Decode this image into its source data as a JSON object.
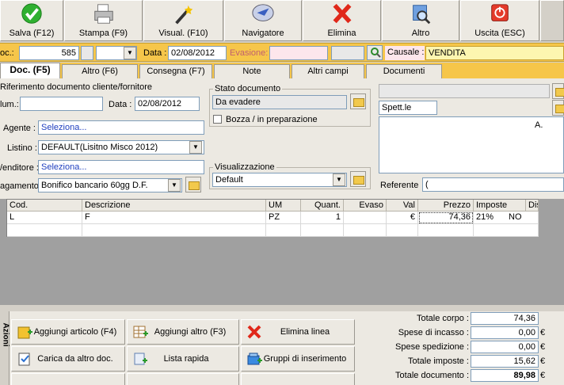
{
  "toolbar": {
    "buttons": [
      {
        "label": "Salva (F12)",
        "icon": "green-check-icon"
      },
      {
        "label": "Stampa (F9)",
        "icon": "printer-icon"
      },
      {
        "label": "Visual. (F10)",
        "icon": "magic-wand-icon"
      },
      {
        "label": "Navigatore",
        "icon": "compass-icon"
      },
      {
        "label": "Elimina",
        "icon": "red-x-icon"
      },
      {
        "label": "Altro",
        "icon": "magnifier-icon"
      },
      {
        "label": "Uscita (ESC)",
        "icon": "exit-icon"
      }
    ]
  },
  "header": {
    "doc_label": "oc.:",
    "doc_number": "585",
    "data_label": "Data :",
    "data_value": "02/08/2012",
    "evasione_label": "Evasione:",
    "evasione_value": "",
    "causale_label": "Causale :",
    "causale_value": "VENDITA"
  },
  "tabs": [
    "Doc. (F5)",
    "Altro (F6)",
    "Consegna (F7)",
    "Note",
    "Altri campi",
    "Documenti"
  ],
  "riferimento": {
    "title": "Riferimento documento cliente/fornitore",
    "num_label": "lum.:",
    "num_value": "",
    "data_label": "Data :",
    "data_value": "02/08/2012"
  },
  "fields": {
    "agente_label": "Agente :",
    "agente_value": "Seleziona...",
    "listino_label": "Listino :",
    "listino_value": "DEFAULT(Lisitno Misco 2012)",
    "venditore_label": "/enditore :",
    "venditore_value": "Seleziona...",
    "pagamento_label": "agamento :",
    "pagamento_value": "Bonifico bancario 60gg D.F."
  },
  "stato": {
    "title": "Stato documento",
    "value": "Da evadere",
    "bozza_label": "Bozza / in preparazione"
  },
  "visualizzazione": {
    "title": "Visualizzazione",
    "value": "Default"
  },
  "cliente": {
    "spett": "Spett.le",
    "a_label": "A.",
    "referente_label": "Referente",
    "referente_value": "("
  },
  "grid": {
    "columns": [
      "Cod.",
      "Descrizione",
      "UM",
      "Quant.",
      "Evaso",
      "Val",
      "Prezzo",
      "Imposte",
      "Disp."
    ],
    "rows": [
      [
        "L",
        "F",
        "PZ",
        "1",
        "",
        "€",
        "74,36",
        "21%",
        "NO"
      ]
    ]
  },
  "actions": [
    {
      "label": "Aggiungi articolo (F4)",
      "icon": "add-article-icon"
    },
    {
      "label": "Aggiungi altro (F3)",
      "icon": "add-other-icon"
    },
    {
      "label": "Elimina linea",
      "icon": "delete-line-icon"
    },
    {
      "label": "Carica da altro doc.",
      "icon": "load-doc-icon"
    },
    {
      "label": "Lista rapida",
      "icon": "quick-list-icon"
    },
    {
      "label": "Gruppi di inserimento",
      "icon": "groups-icon"
    }
  ],
  "side_tab_label": "Azioni",
  "totals": [
    {
      "label": "Totale corpo :",
      "value": "74,36",
      "currency": "€"
    },
    {
      "label": "Spese di incasso :",
      "value": "0,00",
      "currency": "€"
    },
    {
      "label": "Spese spedizione :",
      "value": "0,00",
      "currency": "€"
    },
    {
      "label": "Totale imposte :",
      "value": "15,62",
      "currency": "€"
    },
    {
      "label": "Totale documento :",
      "value": "89,98",
      "currency": "€"
    }
  ]
}
